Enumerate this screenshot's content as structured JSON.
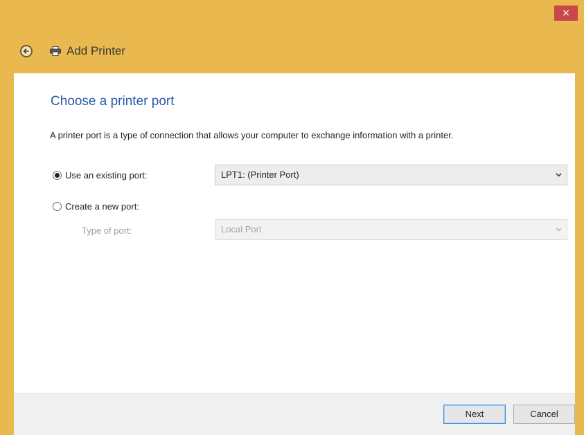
{
  "window": {
    "title": "Add Printer",
    "close_label": "×",
    "accent_color": "#e9b94f",
    "close_color": "#c9474b"
  },
  "icons": {
    "back": "back-arrow-icon",
    "app": "printer-icon",
    "dropdown": "chevron-down-icon"
  },
  "page": {
    "heading": "Choose a printer port",
    "description": "A printer port is a type of connection that allows your computer to exchange information with a printer."
  },
  "options": {
    "existing_port": {
      "label": "Use an existing port:",
      "selected": true,
      "value": "LPT1: (Printer Port)"
    },
    "new_port": {
      "label": "Create a new port:",
      "selected": false,
      "type_label": "Type of port:",
      "type_value": "Local Port",
      "enabled": false
    }
  },
  "footer": {
    "next_label": "Next",
    "cancel_label": "Cancel"
  }
}
